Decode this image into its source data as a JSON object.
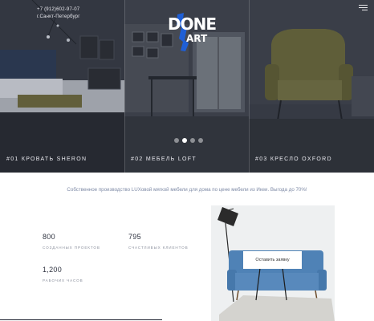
{
  "header": {
    "phone": "+7 (912)602-97-07",
    "city": "г.Санкт-Петербург",
    "logo_line1": "DONE",
    "logo_line2": "ART",
    "menu_icon": "hamburger-menu-icon"
  },
  "hero": {
    "slides": [
      {
        "caption": "#01 КРОВАТЬ SHERON"
      },
      {
        "caption": "#02 МЕБЕЛЬ LOFT"
      },
      {
        "caption": "#03 КРЕСЛО OXFORD"
      }
    ],
    "pager": {
      "total": 4,
      "active": 2
    }
  },
  "main": {
    "tagline": "Собственное производство LUXовой мягкой мебели для дома по цене мебели из Икеи. Выгода до 70%!",
    "stats": [
      {
        "value": "800",
        "label": "СОЗДАННЫХ ПРОЕКТОВ"
      },
      {
        "value": "795",
        "label": "СЧАСТЛИВЫХ КЛИЕНТОВ"
      },
      {
        "value": "1,200",
        "label": "РАБОЧИХ ЧАСОВ"
      }
    ],
    "cta_label": "Оставить заявку"
  },
  "colors": {
    "hero_overlay": "#2f333d",
    "logo_accent": "#1f5fd6",
    "tagline": "#7e8aa6",
    "sofa": "#4f82b6"
  }
}
